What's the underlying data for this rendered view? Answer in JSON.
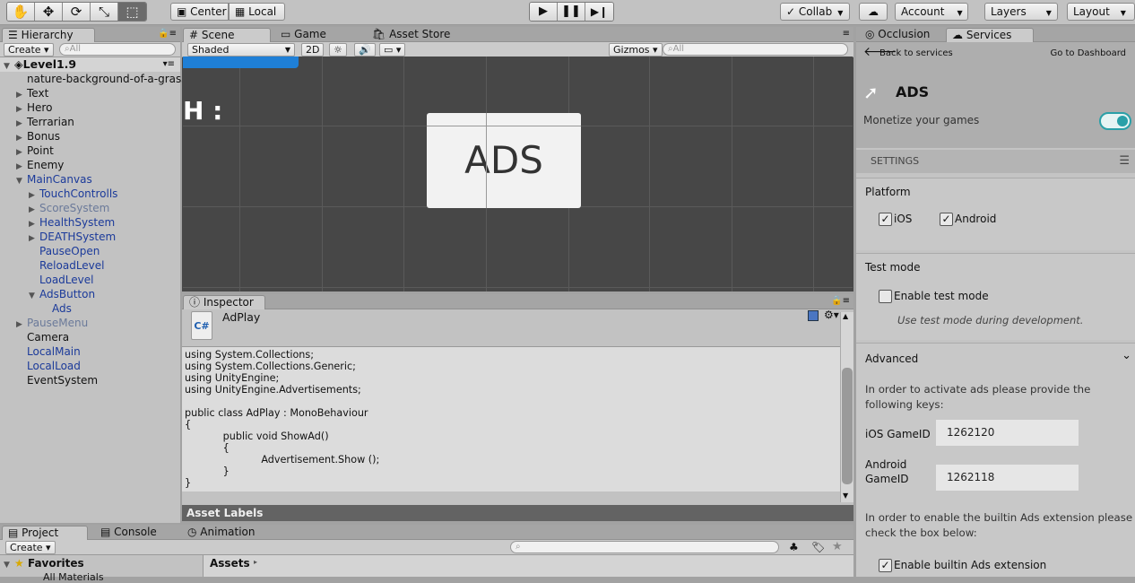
{
  "toolbar": {
    "center": "Center",
    "local": "Local",
    "collab": "Collab",
    "account": "Account",
    "layers": "Layers",
    "layout": "Layout"
  },
  "hierarchy": {
    "tab": "Hierarchy",
    "create": "Create",
    "search": "All",
    "scene": "Level1.9",
    "items": [
      {
        "label": "nature-background-of-a-grass"
      },
      {
        "label": "Text"
      },
      {
        "label": "Hero"
      },
      {
        "label": "Terrarian"
      },
      {
        "label": "Bonus"
      },
      {
        "label": "Point"
      },
      {
        "label": "Enemy"
      },
      {
        "label": "MainCanvas"
      },
      {
        "label": "TouchControlls"
      },
      {
        "label": "ScoreSystem"
      },
      {
        "label": "HealthSystem"
      },
      {
        "label": "DEATHSystem"
      },
      {
        "label": "PauseOpen"
      },
      {
        "label": "ReloadLevel"
      },
      {
        "label": "LoadLevel"
      },
      {
        "label": "AdsButton"
      },
      {
        "label": "Ads"
      },
      {
        "label": "PauseMenu"
      },
      {
        "label": "Camera"
      },
      {
        "label": "LocalMain"
      },
      {
        "label": "LocalLoad"
      },
      {
        "label": "EventSystem"
      }
    ]
  },
  "scene": {
    "tab_scene": "Scene",
    "tab_game": "Game",
    "tab_store": "Asset Store",
    "shaded": "Shaded",
    "mode2d": "2D",
    "gizmos": "Gizmos",
    "search": "All",
    "button_text": "ADS",
    "partial_text": "H :"
  },
  "inspector": {
    "tab": "Inspector",
    "script_name": "AdPlay",
    "script_icon": "C#",
    "code": [
      "using System.Collections;",
      "using System.Collections.Generic;",
      "using UnityEngine;",
      "using UnityEngine.Advertisements;",
      "",
      "public class AdPlay : MonoBehaviour",
      "{",
      "            public void ShowAd()",
      "            {",
      "                        Advertisement.Show ();",
      "            }",
      "}"
    ],
    "asset_labels": "Asset Labels"
  },
  "project": {
    "tab_project": "Project",
    "tab_console": "Console",
    "tab_animation": "Animation",
    "create": "Create",
    "favorites": "Favorites",
    "all_materials": "All Materials",
    "assets": "Assets"
  },
  "services": {
    "tab_occlusion": "Occlusion",
    "tab_services": "Services",
    "back": "Back to services",
    "dashboard": "Go to Dashboard",
    "title": "ADS",
    "monetize": "Monetize your games",
    "settings": "SETTINGS",
    "platform": "Platform",
    "ios": "iOS",
    "android": "Android",
    "test_mode": "Test mode",
    "enable_test": "Enable test mode",
    "test_hint": "Use test mode during development.",
    "advanced": "Advanced",
    "adv_text": "In order to activate ads please provide the following keys:",
    "ios_gameid_label": "iOS GameID",
    "ios_gameid": "1262120",
    "android_gameid_label": "Android GameID",
    "android_gameid": "1262118",
    "builtin_text": "In order to enable the builtin Ads extension please check the box below:",
    "enable_builtin": "Enable builtin Ads extension",
    "accent": "#2aa0a8"
  }
}
